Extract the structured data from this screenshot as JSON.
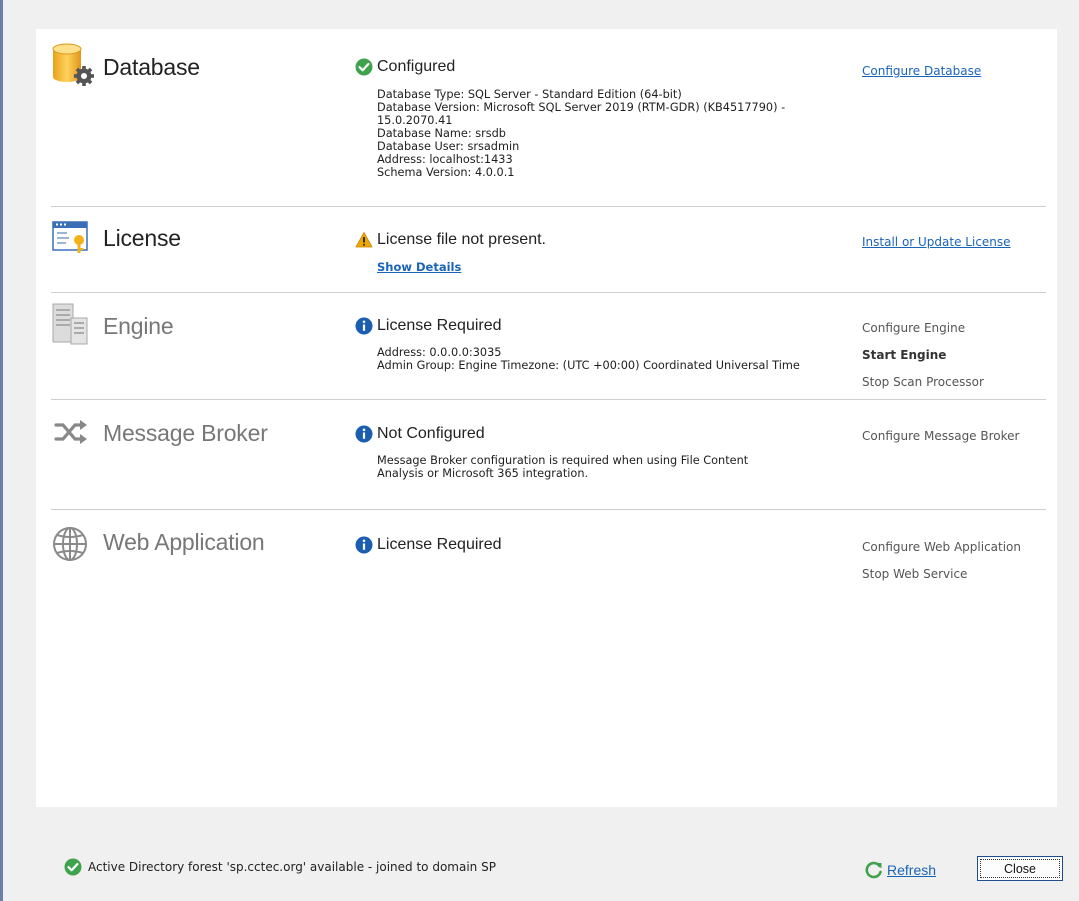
{
  "sections": [
    {
      "title": "Database",
      "icon": "database-gear-icon",
      "status": "Configured",
      "status_icon": "check-circle-icon",
      "details": [
        "Database Type: SQL Server - Standard Edition (64-bit)",
        "Database Version: Microsoft SQL Server 2019 (RTM-GDR) (KB4517790)  -",
        "15.0.2070.41",
        "Database Name: srsdb",
        "Database User: srsadmin",
        "Address: localhost:1433",
        "Schema Version: 4.0.0.1"
      ],
      "actions": [
        "Configure Database"
      ]
    },
    {
      "title": "License",
      "icon": "license-certificate-icon",
      "status": "License file not present.",
      "status_icon": "warning-icon",
      "show_details": "Show Details",
      "actions": [
        "Install or Update License"
      ]
    },
    {
      "title": "Engine",
      "icon": "server-icon",
      "status": "License Required",
      "status_icon": "info-icon",
      "details": [
        "Address: 0.0.0.0:3035",
        "Admin Group:  Engine Timezone: (UTC +00:00)  Coordinated Universal Time"
      ],
      "actions": [
        "Configure Engine",
        "Start Engine",
        "Stop Scan Processor"
      ]
    },
    {
      "title": "Message Broker",
      "icon": "shuffle-icon",
      "status": "Not Configured",
      "status_icon": "info-icon",
      "details": [
        "Message Broker configuration is required when using File Content",
        "Analysis or Microsoft 365 integration."
      ],
      "actions": [
        "Configure Message Broker"
      ]
    },
    {
      "title": "Web Application",
      "icon": "globe-icon",
      "status": "License Required",
      "status_icon": "info-icon",
      "actions": [
        "Configure Web Application",
        "Stop Web Service"
      ]
    }
  ],
  "footer": {
    "status": "Active Directory forest 'sp.cctec.org' available - joined to domain SP",
    "refresh_label": "Refresh",
    "close_label": "Close"
  },
  "colors": {
    "link": "#1a64b8",
    "success": "#3fa34d",
    "warning": "#f0a800",
    "info": "#1b5eb0"
  }
}
